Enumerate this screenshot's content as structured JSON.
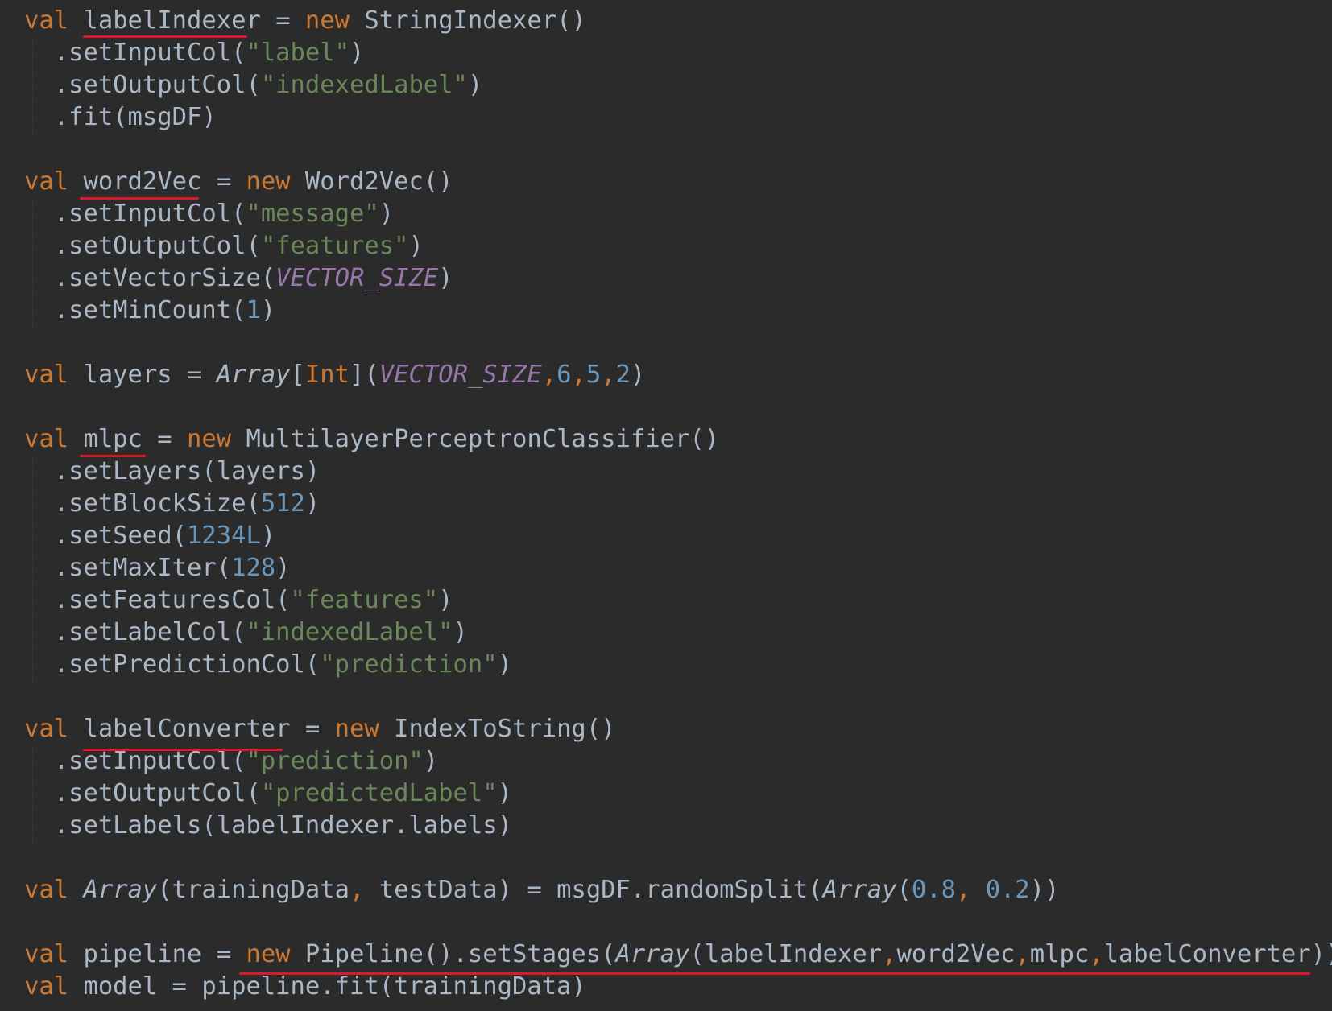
{
  "editor": {
    "theme": {
      "background": "#2b2b2b",
      "keyword": "#cc7832",
      "string": "#6a8759",
      "number": "#6897bb",
      "constant": "#9876aa",
      "text": "#a9b7c6",
      "annotation_underline": "#e0162b"
    },
    "lines": [
      [
        {
          "t": "kw",
          "v": "val"
        },
        {
          "t": "sq",
          "v": " "
        },
        {
          "t": "sq",
          "v": "labelIndexer"
        },
        {
          "t": "sq",
          "v": " = "
        },
        {
          "t": "kw",
          "v": "new"
        },
        {
          "t": "sq",
          "v": " StringIndexer()"
        }
      ],
      [
        {
          "t": "sq",
          "v": "  .setInputCol("
        },
        {
          "t": "str",
          "v": "\"label\""
        },
        {
          "t": "sq",
          "v": ")"
        }
      ],
      [
        {
          "t": "sq",
          "v": "  .setOutputCol("
        },
        {
          "t": "str",
          "v": "\"indexedLabel\""
        },
        {
          "t": "sq",
          "v": ")"
        }
      ],
      [
        {
          "t": "sq",
          "v": "  .fit(msgDF)"
        }
      ],
      [],
      [
        {
          "t": "kw",
          "v": "val"
        },
        {
          "t": "sq",
          "v": " word2Vec = "
        },
        {
          "t": "kw",
          "v": "new"
        },
        {
          "t": "sq",
          "v": " Word2Vec()"
        }
      ],
      [
        {
          "t": "sq",
          "v": "  .setInputCol("
        },
        {
          "t": "str",
          "v": "\"message\""
        },
        {
          "t": "sq",
          "v": ")"
        }
      ],
      [
        {
          "t": "sq",
          "v": "  .setOutputCol("
        },
        {
          "t": "str",
          "v": "\"features\""
        },
        {
          "t": "sq",
          "v": ")"
        }
      ],
      [
        {
          "t": "sq",
          "v": "  .setVectorSize("
        },
        {
          "t": "const",
          "v": "VECTOR_SIZE"
        },
        {
          "t": "sq",
          "v": ")"
        }
      ],
      [
        {
          "t": "sq",
          "v": "  .setMinCount("
        },
        {
          "t": "num",
          "v": "1"
        },
        {
          "t": "sq",
          "v": ")"
        }
      ],
      [],
      [
        {
          "t": "kw",
          "v": "val"
        },
        {
          "t": "sq",
          "v": " layers = "
        },
        {
          "t": "it",
          "v": "Array"
        },
        {
          "t": "sq",
          "v": "["
        },
        {
          "t": "kw",
          "v": "Int"
        },
        {
          "t": "sq",
          "v": "]("
        },
        {
          "t": "const",
          "v": "VECTOR_SIZE"
        },
        {
          "t": "kw",
          "v": ","
        },
        {
          "t": "num",
          "v": "6"
        },
        {
          "t": "kw",
          "v": ","
        },
        {
          "t": "num",
          "v": "5"
        },
        {
          "t": "kw",
          "v": ","
        },
        {
          "t": "num",
          "v": "2"
        },
        {
          "t": "sq",
          "v": ")"
        }
      ],
      [],
      [
        {
          "t": "kw",
          "v": "val"
        },
        {
          "t": "sq",
          "v": " mlpc = "
        },
        {
          "t": "kw",
          "v": "new"
        },
        {
          "t": "sq",
          "v": " MultilayerPerceptronClassifier()"
        }
      ],
      [
        {
          "t": "sq",
          "v": "  .setLayers(layers)"
        }
      ],
      [
        {
          "t": "sq",
          "v": "  .setBlockSize("
        },
        {
          "t": "num",
          "v": "512"
        },
        {
          "t": "sq",
          "v": ")"
        }
      ],
      [
        {
          "t": "sq",
          "v": "  .setSeed("
        },
        {
          "t": "num",
          "v": "1234L"
        },
        {
          "t": "sq",
          "v": ")"
        }
      ],
      [
        {
          "t": "sq",
          "v": "  .setMaxIter("
        },
        {
          "t": "num",
          "v": "128"
        },
        {
          "t": "sq",
          "v": ")"
        }
      ],
      [
        {
          "t": "sq",
          "v": "  .setFeaturesCol("
        },
        {
          "t": "str",
          "v": "\"features\""
        },
        {
          "t": "sq",
          "v": ")"
        }
      ],
      [
        {
          "t": "sq",
          "v": "  .setLabelCol("
        },
        {
          "t": "str",
          "v": "\"indexedLabel\""
        },
        {
          "t": "sq",
          "v": ")"
        }
      ],
      [
        {
          "t": "sq",
          "v": "  .setPredictionCol("
        },
        {
          "t": "str",
          "v": "\"prediction\""
        },
        {
          "t": "sq",
          "v": ")"
        }
      ],
      [],
      [
        {
          "t": "kw",
          "v": "val"
        },
        {
          "t": "sq",
          "v": " labelConverter = "
        },
        {
          "t": "kw",
          "v": "new"
        },
        {
          "t": "sq",
          "v": " IndexToString()"
        }
      ],
      [
        {
          "t": "sq",
          "v": "  .setInputCol("
        },
        {
          "t": "str",
          "v": "\"prediction\""
        },
        {
          "t": "sq",
          "v": ")"
        }
      ],
      [
        {
          "t": "sq",
          "v": "  .setOutputCol("
        },
        {
          "t": "str",
          "v": "\"predictedLabel\""
        },
        {
          "t": "sq",
          "v": ")"
        }
      ],
      [
        {
          "t": "sq",
          "v": "  .setLabels(labelIndexer.labels)"
        }
      ],
      [],
      [
        {
          "t": "kw",
          "v": "val"
        },
        {
          "t": "sq",
          "v": " "
        },
        {
          "t": "it",
          "v": "Array"
        },
        {
          "t": "sq",
          "v": "(trainingData"
        },
        {
          "t": "kw",
          "v": ","
        },
        {
          "t": "sq",
          "v": " testData) = msgDF.randomSplit("
        },
        {
          "t": "it",
          "v": "Array"
        },
        {
          "t": "sq",
          "v": "("
        },
        {
          "t": "num",
          "v": "0.8"
        },
        {
          "t": "kw",
          "v": ","
        },
        {
          "t": "sq",
          "v": " "
        },
        {
          "t": "num",
          "v": "0.2"
        },
        {
          "t": "sq",
          "v": "))"
        }
      ],
      [],
      [
        {
          "t": "kw",
          "v": "val"
        },
        {
          "t": "sq",
          "v": " pipeline = "
        },
        {
          "t": "kw",
          "v": "new"
        },
        {
          "t": "sq",
          "v": " Pipeline().setStages("
        },
        {
          "t": "it",
          "v": "Array"
        },
        {
          "t": "sq",
          "v": "(labelIndexer"
        },
        {
          "t": "kw",
          "v": ","
        },
        {
          "t": "sq",
          "v": "word2Vec"
        },
        {
          "t": "kw",
          "v": ","
        },
        {
          "t": "sq",
          "v": "mlpc"
        },
        {
          "t": "kw",
          "v": ","
        },
        {
          "t": "sq",
          "v": "labelConverter))"
        }
      ],
      [
        {
          "t": "kw",
          "v": "val"
        },
        {
          "t": "sq",
          "v": " model = pipeline.fit(trainingData)"
        }
      ]
    ]
  }
}
